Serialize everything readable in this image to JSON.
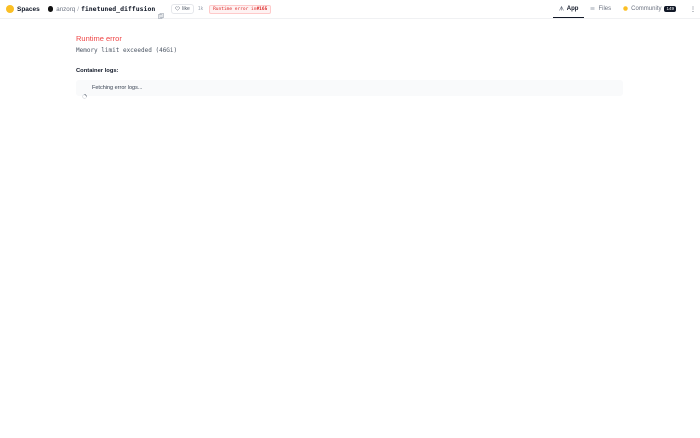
{
  "header": {
    "section_label": "Spaces",
    "owner": "anzorq",
    "repo_name": "finetuned_diffusion",
    "like_label": "like",
    "like_count": "1k",
    "status": {
      "prefix": "Runtime error in ",
      "highlight": "#165"
    },
    "tabs": [
      {
        "label": "App",
        "active": true
      },
      {
        "label": "Files",
        "active": false
      },
      {
        "label": "Community",
        "active": false,
        "count": "149"
      }
    ]
  },
  "main": {
    "error_title": "Runtime error",
    "error_detail": "Memory limit exceeded (46Gi)",
    "logs_label": "Container logs:",
    "logs_status": "Fetching error logs..."
  },
  "colors": {
    "accent": "#ef4444",
    "logo": "#fbbf24"
  }
}
